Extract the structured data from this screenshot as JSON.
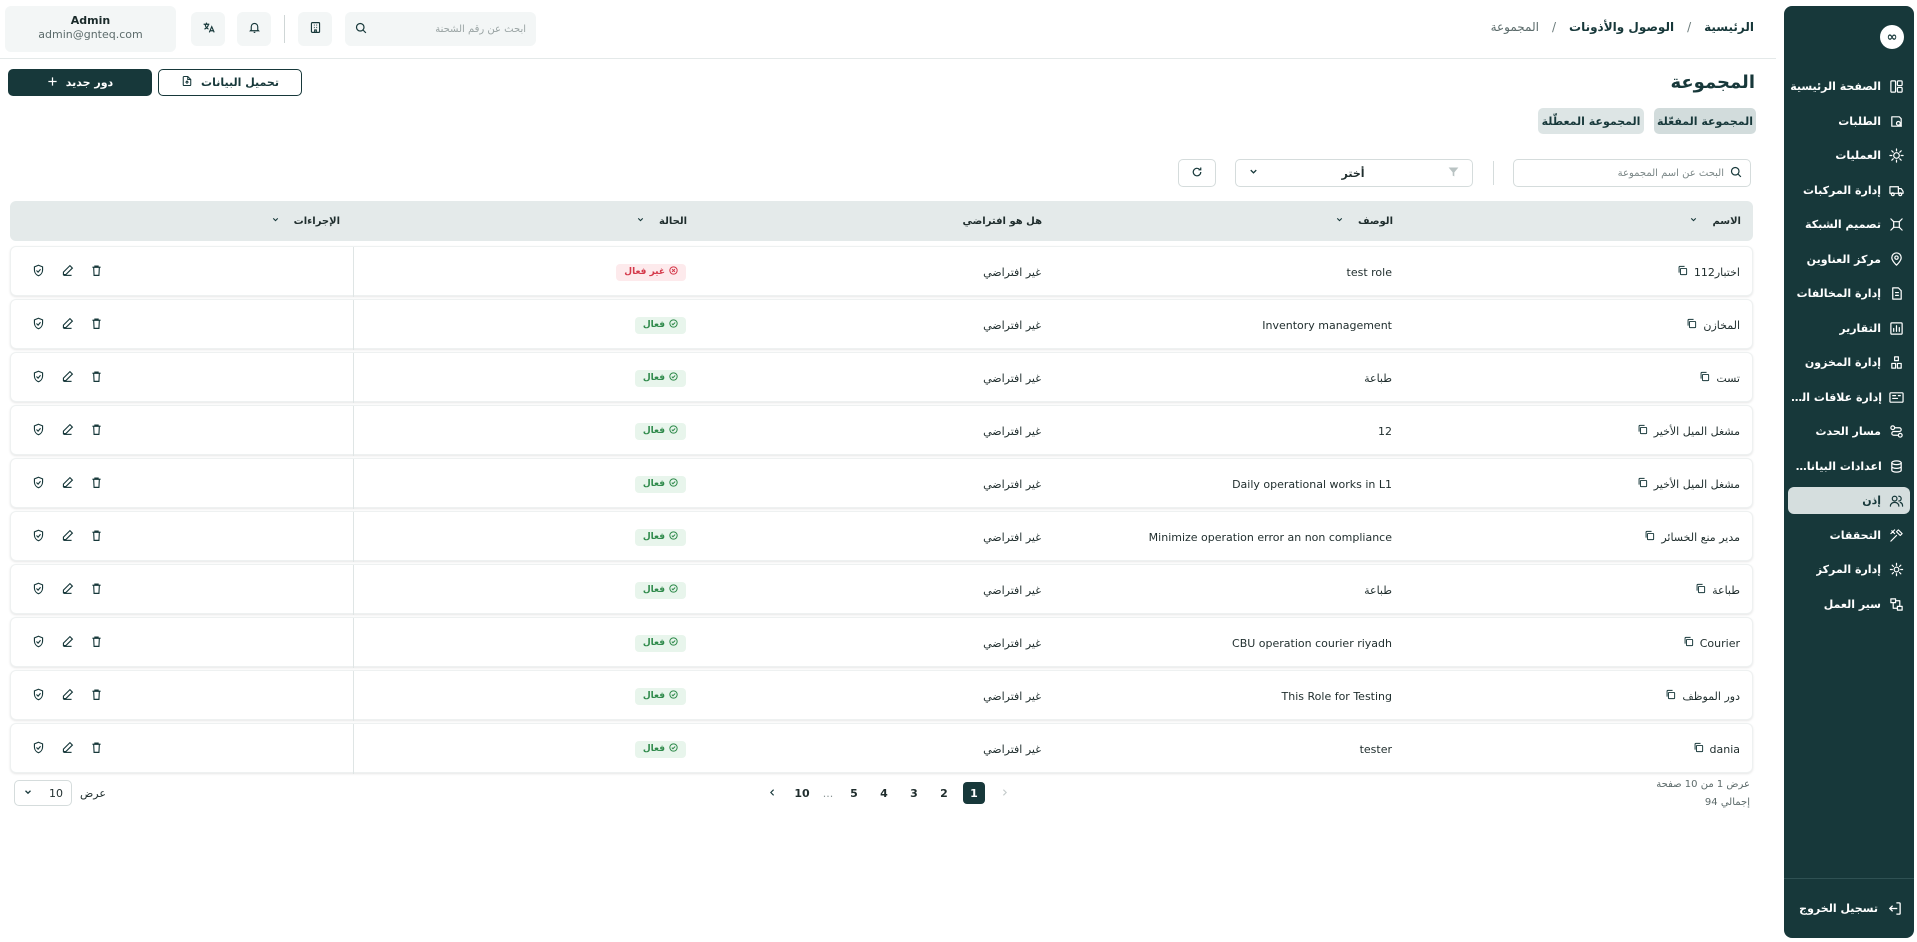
{
  "sidebar": {
    "logo": "∞",
    "items": [
      {
        "label": "الصفحة الرئيسية",
        "icon": "dashboard-icon"
      },
      {
        "label": "الطلبات",
        "icon": "orders-icon"
      },
      {
        "label": "العمليات",
        "icon": "operations-icon"
      },
      {
        "label": "إدارة المركبات",
        "icon": "truck-icon"
      },
      {
        "label": "تصميم الشبكة",
        "icon": "network-icon"
      },
      {
        "label": "مركز العناوين",
        "icon": "location-icon"
      },
      {
        "label": "إدارة المخالفات",
        "icon": "violations-icon"
      },
      {
        "label": "التقارير",
        "icon": "reports-icon"
      },
      {
        "label": "إدارة المخزون",
        "icon": "inventory-icon"
      },
      {
        "label": "إدارة علاقات العملاء",
        "icon": "crm-icon"
      },
      {
        "label": "مسار الحدث",
        "icon": "route-icon"
      },
      {
        "label": "اعدادات البيانات...",
        "icon": "database-icon"
      },
      {
        "label": "إذن",
        "icon": "users-icon",
        "active": true
      },
      {
        "label": "التحققات",
        "icon": "tools-icon"
      },
      {
        "label": "إدارة المركز",
        "icon": "gear-icon"
      },
      {
        "label": "سير العمل",
        "icon": "workflow-icon"
      }
    ],
    "logout": "تسجيل الخروج"
  },
  "header": {
    "breadcrumb": {
      "home": "الرئيسية",
      "section": "الوصول والأذونات",
      "current": "المجموعة",
      "sep": "/"
    },
    "search_placeholder": "ابحث عن رقم الشحنة",
    "user": {
      "name": "Admin",
      "email": "admin@gnteq.com"
    }
  },
  "page": {
    "title": "المجموعة",
    "new_button": "دور جديد",
    "upload_button": "تحميل البيانات",
    "tabs": {
      "enabled": "المجموعة المفعّلة",
      "disabled": "المجموعة المعطّلة"
    }
  },
  "filters": {
    "search_placeholder": "البحث عن اسم المجموعة",
    "select_label": "أختر"
  },
  "table": {
    "columns": {
      "name": "الاسم",
      "description": "الوصف",
      "is_default": "هل هو افتراضي",
      "status": "الحالة",
      "actions": "الإجراءات"
    },
    "rows": [
      {
        "name": "اختبار112",
        "description": "test role",
        "is_default": "غير افتراضي",
        "status": "غير فعال",
        "active": false
      },
      {
        "name": "المخازن",
        "description": "Inventory management",
        "is_default": "غير افتراضي",
        "status": "فعال",
        "active": true
      },
      {
        "name": "تست",
        "description": "طباعة",
        "is_default": "غير افتراضي",
        "status": "فعال",
        "active": true
      },
      {
        "name": "مشغل الميل الأخير",
        "description": "12",
        "is_default": "غير افتراضي",
        "status": "فعال",
        "active": true
      },
      {
        "name": "مشغل الميل الأخير",
        "description": "Daily operational works in L1",
        "is_default": "غير افتراضي",
        "status": "فعال",
        "active": true
      },
      {
        "name": "مدير منع الخسائر",
        "description": "Minimize operation error an non compliance",
        "is_default": "غير افتراضي",
        "status": "فعال",
        "active": true
      },
      {
        "name": "طباعة",
        "description": "طباعة",
        "is_default": "غير افتراضي",
        "status": "فعال",
        "active": true
      },
      {
        "name": "Courier",
        "description": "CBU operation courier riyadh",
        "is_default": "غير افتراضي",
        "status": "فعال",
        "active": true
      },
      {
        "name": "دور الموظف",
        "description": "This Role for Testing",
        "is_default": "غير افتراضي",
        "status": "فعال",
        "active": true
      },
      {
        "name": "dania",
        "description": "tester",
        "is_default": "غير افتراضي",
        "status": "فعال",
        "active": true
      }
    ]
  },
  "pagination": {
    "info_line1": "عرض 1 من 10 صفحة",
    "info_line2": "إجمالي 94",
    "pages": [
      "1",
      "2",
      "3",
      "4",
      "5",
      "...",
      "10"
    ],
    "current_page": "1",
    "per_page_label": "عرض",
    "per_page_value": "10"
  },
  "colors": {
    "primary": "#17383a",
    "active_status": "#2f8a4b",
    "inactive_status": "#d4394a"
  }
}
